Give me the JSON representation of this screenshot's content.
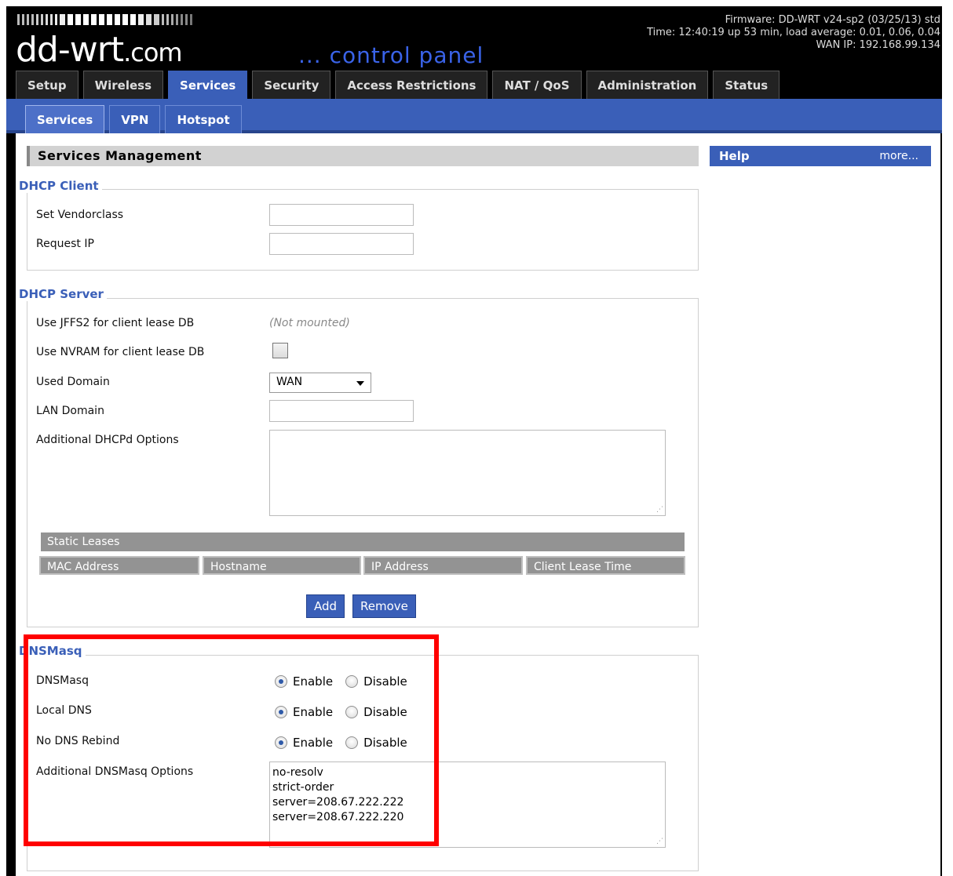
{
  "header": {
    "logo_text": "dd-wrt",
    "logo_suffix": ".com",
    "panel_text": "... control panel",
    "firmware": "Firmware: DD-WRT v24-sp2 (03/25/13) std",
    "time": "Time: 12:40:19 up 53 min, load average: 0.01, 0.06, 0.04",
    "wan_ip": "WAN IP: 192.168.99.134"
  },
  "main_tabs": [
    "Setup",
    "Wireless",
    "Services",
    "Security",
    "Access Restrictions",
    "NAT / QoS",
    "Administration",
    "Status"
  ],
  "main_tabs_active": "Services",
  "sub_tabs": [
    "Services",
    "VPN",
    "Hotspot"
  ],
  "sub_tabs_active": "Services",
  "section_title": "Services Management",
  "help": {
    "title": "Help",
    "more": "more..."
  },
  "dhcp_client": {
    "legend": "DHCP Client",
    "vendorclass_label": "Set Vendorclass",
    "vendorclass_value": "",
    "request_ip_label": "Request IP",
    "request_ip_value": ""
  },
  "dhcp_server": {
    "legend": "DHCP Server",
    "jffs2_label": "Use JFFS2 for client lease DB",
    "jffs2_note": "(Not mounted)",
    "nvram_label": "Use NVRAM for client lease DB",
    "nvram_checked": false,
    "used_domain_label": "Used Domain",
    "used_domain_value": "WAN",
    "lan_domain_label": "LAN Domain",
    "lan_domain_value": "",
    "additional_label": "Additional DHCPd Options",
    "additional_value": "",
    "static_leases_title": "Static Leases",
    "static_leases_columns": [
      "MAC Address",
      "Hostname",
      "IP Address",
      "Client Lease Time"
    ],
    "add_button": "Add",
    "remove_button": "Remove"
  },
  "dnsmasq": {
    "legend": "DNSMasq",
    "rows": [
      {
        "label": "DNSMasq",
        "enabled": true
      },
      {
        "label": "Local DNS",
        "enabled": true
      },
      {
        "label": "No DNS Rebind",
        "enabled": true
      }
    ],
    "enable_label": "Enable",
    "disable_label": "Disable",
    "additional_label": "Additional DNSMasq Options",
    "additional_value": "no-resolv\nstrict-order\nserver=208.67.222.222\nserver=208.67.222.220"
  },
  "colors": {
    "accent": "#3a5fb8",
    "header_bg": "#000000",
    "highlight": "#ff0000"
  }
}
